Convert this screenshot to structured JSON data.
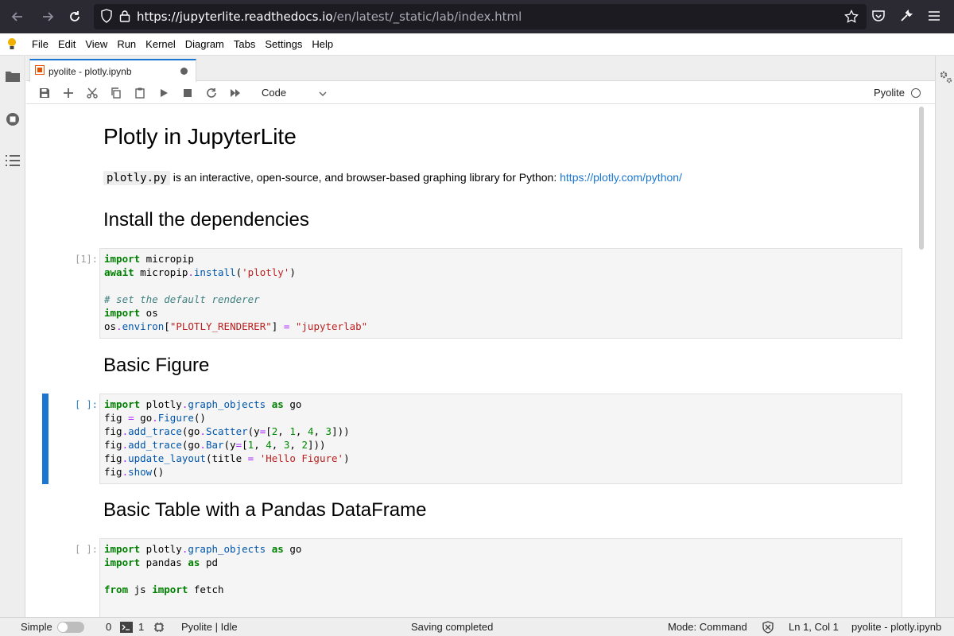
{
  "browser": {
    "url_host": "https://jupyterlite.readthedocs.io",
    "url_path": "/en/latest/_static/lab/index.html"
  },
  "menubar": {
    "items": [
      "File",
      "Edit",
      "View",
      "Run",
      "Kernel",
      "Diagram",
      "Tabs",
      "Settings",
      "Help"
    ]
  },
  "tab": {
    "label": "pyolite - plotly.ipynb"
  },
  "toolbar": {
    "cell_type": "Code",
    "kernel": "Pyolite"
  },
  "notebook": {
    "title": "Plotly in JupyterLite",
    "intro_code": "plotly.py",
    "intro_text": " is an interactive, open-source, and browser-based graphing library for Python: ",
    "intro_link": "https://plotly.com/python/",
    "h_install": "Install the dependencies",
    "prompt_1": "[1]:",
    "h_basic_figure": "Basic Figure",
    "prompt_2": "[ ]:",
    "h_basic_table": "Basic Table with a Pandas DataFrame",
    "prompt_3": "[ ]:"
  },
  "statusbar": {
    "simple_label": "Simple",
    "terminals_count": "0",
    "kernels_count": "1",
    "kernel_status": "Pyolite | Idle",
    "saving": "Saving completed",
    "mode": "Mode: Command",
    "cursor": "Ln 1, Col 1",
    "file": "pyolite - plotly.ipynb"
  }
}
